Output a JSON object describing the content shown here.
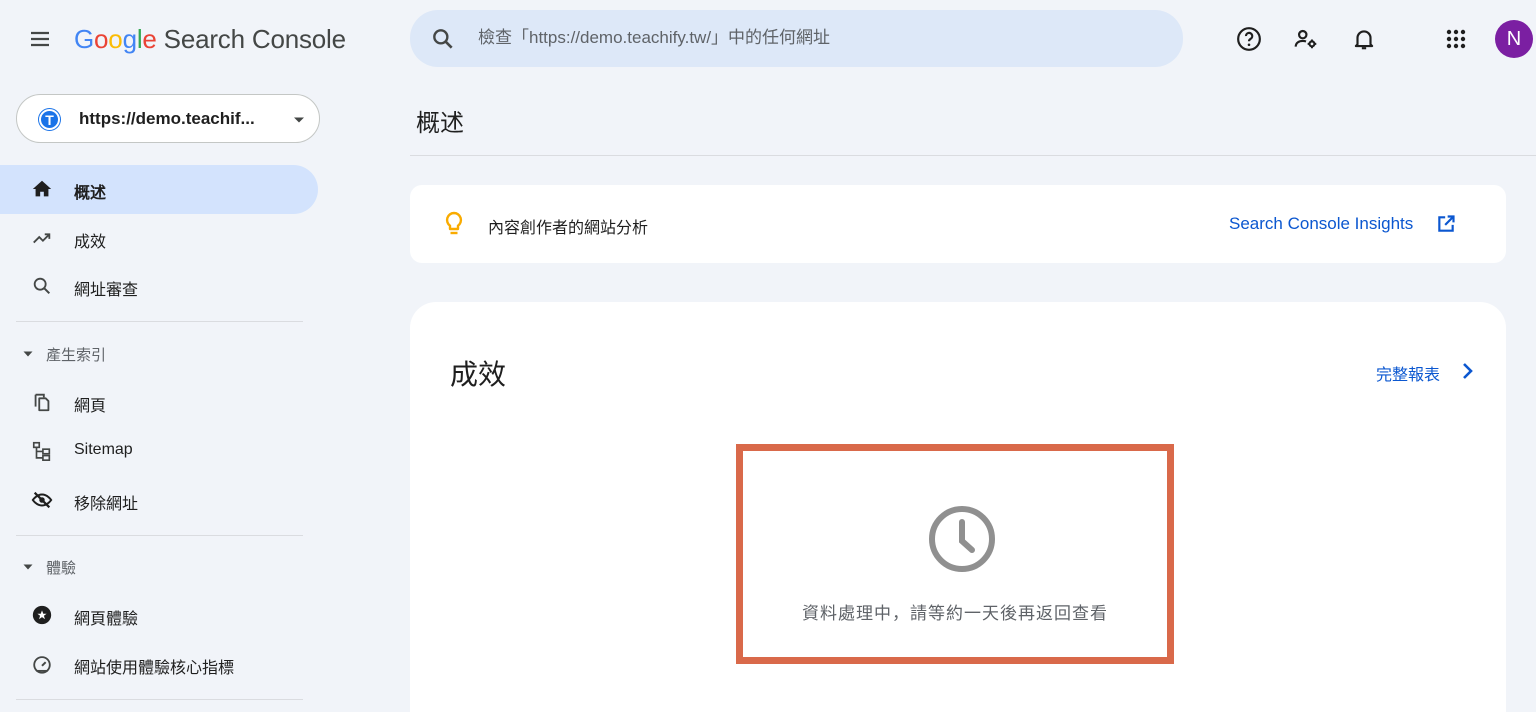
{
  "header": {
    "logo_letters": [
      "G",
      "o",
      "o",
      "g",
      "l",
      "e"
    ],
    "product_name": "Search Console",
    "search_placeholder": "檢查「https://demo.teachify.tw/」中的任何網址",
    "avatar_initial": "N",
    "icons": [
      "menu-icon",
      "search-icon",
      "help-icon",
      "manage-users-icon",
      "notifications-icon",
      "apps-grid-icon"
    ]
  },
  "sidebar": {
    "property_label": "https://demo.teachif...",
    "property_favicon": "T",
    "items": [
      {
        "label": "概述",
        "icon": "home-icon",
        "active": true
      },
      {
        "label": "成效",
        "icon": "trending-up-icon"
      },
      {
        "label": "網址審查",
        "icon": "search-icon"
      }
    ],
    "sections": [
      {
        "label": "產生索引",
        "items": [
          {
            "label": "網頁",
            "icon": "pages-icon"
          },
          {
            "label": "Sitemap",
            "icon": "sitemap-icon"
          },
          {
            "label": "移除網址",
            "icon": "visibility-off-icon"
          }
        ]
      },
      {
        "label": "體驗",
        "items": [
          {
            "label": "網頁體驗",
            "icon": "page-experience-icon"
          },
          {
            "label": "網站使用體驗核心指標",
            "icon": "speed-gauge-icon"
          }
        ]
      }
    ]
  },
  "main": {
    "page_title": "概述",
    "insights": {
      "label": "內容創作者的網站分析",
      "link_label": "Search Console Insights",
      "icon": "lightbulb-icon"
    },
    "performance": {
      "title": "成效",
      "full_report_label": "完整報表",
      "processing_message": "資料處理中，請等約一天後再返回查看",
      "icon": "clock-icon"
    }
  },
  "colors": {
    "background": "#f1f4f9",
    "accent": "#0b57d0",
    "active_nav": "#d3e3fd",
    "search_bar": "#dde8f8",
    "avatar": "#7b1fa2",
    "highlight_border": "#d9694a",
    "bulb": "#f9ab00"
  }
}
